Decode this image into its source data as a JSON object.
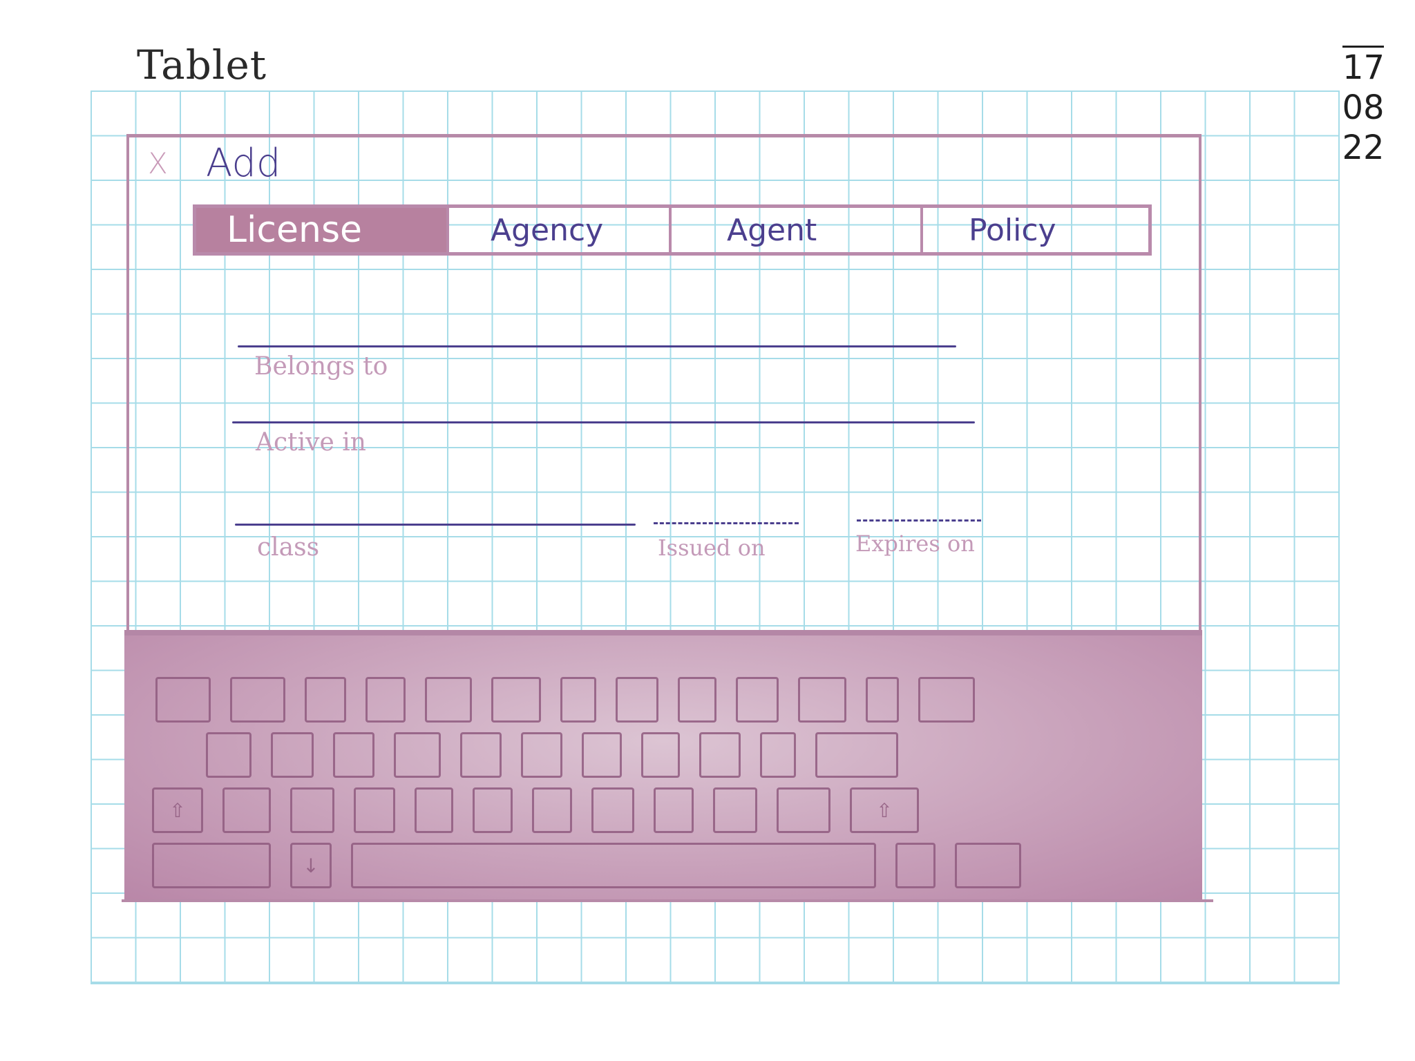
{
  "sheet": {
    "title": "Tablet",
    "date": [
      "17",
      "08",
      "22"
    ]
  },
  "dialog": {
    "close_icon": "close-icon",
    "close_glyph": "X",
    "title": "Add",
    "tabs": [
      {
        "label": "License",
        "active": true
      },
      {
        "label": "Agency",
        "active": false
      },
      {
        "label": "Agent",
        "active": false
      },
      {
        "label": "Policy",
        "active": false
      }
    ]
  },
  "form": {
    "belongs_to": {
      "label": "Belongs to",
      "value": ""
    },
    "active_in": {
      "label": "Active in",
      "value": ""
    },
    "class": {
      "label": "class",
      "value": ""
    },
    "issued_on": {
      "label": "Issued on",
      "value": ""
    },
    "expires_on": {
      "label": "Expires on",
      "value": ""
    }
  },
  "keyboard": {
    "shift_icon": "shift-arrow-icon",
    "down_icon": "down-arrow-icon",
    "shift_glyph": "⇧",
    "down_glyph": "↓"
  },
  "colors": {
    "accent": "#b7819f",
    "ink": "#4b3f8e",
    "label": "#c49ab8",
    "grid": "#a6dce8"
  }
}
